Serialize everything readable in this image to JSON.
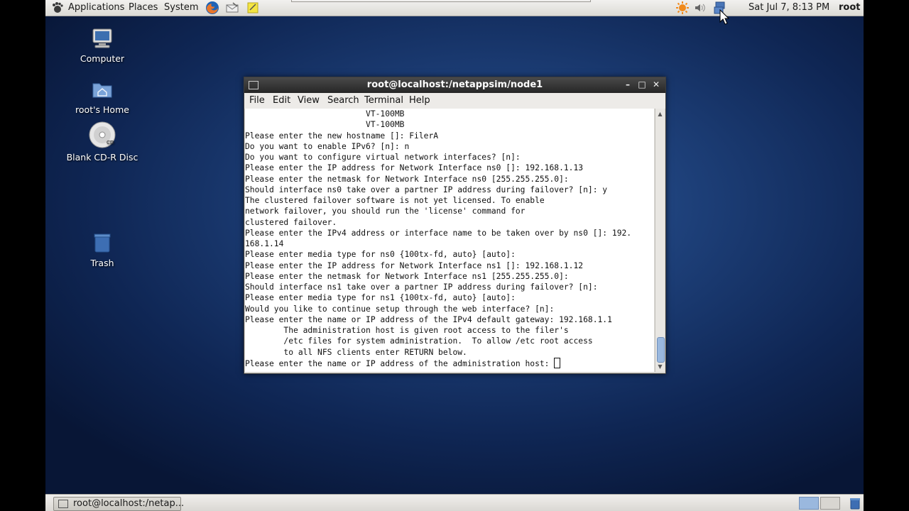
{
  "top_panel": {
    "menus": [
      "Applications",
      "Places",
      "System"
    ],
    "clock": "Sat Jul  7,  8:13 PM",
    "user": "root"
  },
  "desktop_icons": [
    {
      "label": "Computer",
      "icon": "computer-icon"
    },
    {
      "label": "root's Home",
      "icon": "home-folder-icon"
    },
    {
      "label": "Blank CD-R Disc",
      "icon": "cd-disc-icon"
    },
    {
      "label": "Trash",
      "icon": "trash-icon"
    }
  ],
  "terminal": {
    "title": "root@localhost:/netappsim/node1",
    "menus": [
      "File",
      "Edit",
      "View",
      "Search",
      "Terminal",
      "Help"
    ],
    "lines": [
      "                         VT-100MB",
      "                         VT-100MB",
      "Please enter the new hostname []: FilerA",
      "Do you want to enable IPv6? [n]: n",
      "Do you want to configure virtual network interfaces? [n]:",
      "Please enter the IP address for Network Interface ns0 []: 192.168.1.13",
      "Please enter the netmask for Network Interface ns0 [255.255.255.0]:",
      "Should interface ns0 take over a partner IP address during failover? [n]: y",
      "The clustered failover software is not yet licensed. To enable",
      "network failover, you should run the 'license' command for",
      "clustered failover.",
      "Please enter the IPv4 address or interface name to be taken over by ns0 []: 192.",
      "168.1.14",
      "Please enter media type for ns0 {100tx-fd, auto} [auto]:",
      "Please enter the IP address for Network Interface ns1 []: 192.168.1.12",
      "Please enter the netmask for Network Interface ns1 [255.255.255.0]:",
      "Should interface ns1 take over a partner IP address during failover? [n]:",
      "Please enter media type for ns1 {100tx-fd, auto} [auto]:",
      "Would you like to continue setup through the web interface? [n]:",
      "Please enter the name or IP address of the IPv4 default gateway: 192.168.1.1",
      "        The administration host is given root access to the filer's",
      "        /etc files for system administration.  To allow /etc root access",
      "        to all NFS clients enter RETURN below.",
      "Please enter the name or IP address of the administration host: "
    ]
  },
  "taskbar": {
    "task_label": "root@localhost:/netap..."
  }
}
